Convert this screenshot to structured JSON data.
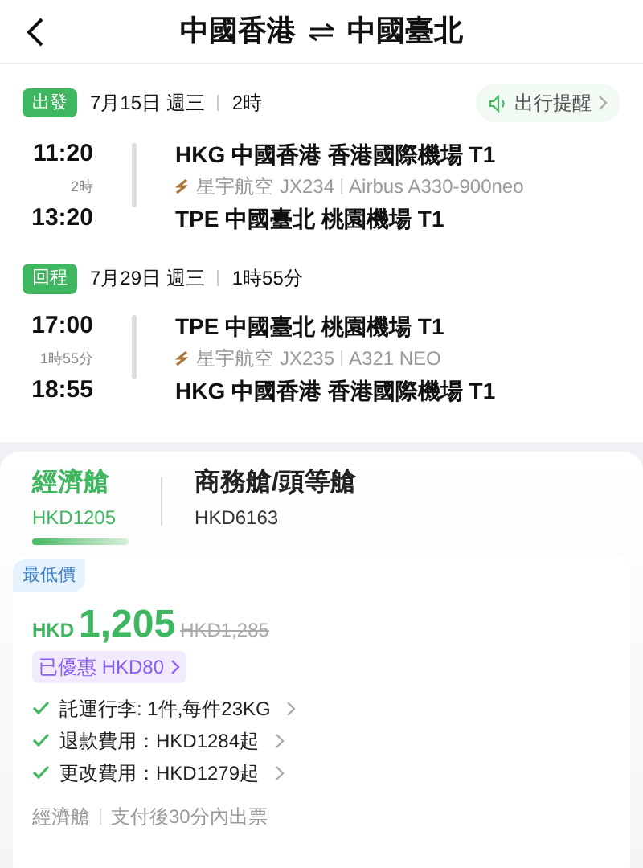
{
  "header": {
    "title_from": "中國香港",
    "title_to": "中國臺北"
  },
  "reminder": {
    "label": "出行提醒"
  },
  "segments": [
    {
      "badge": "出發",
      "date": "7月15日 週三",
      "duration": "2時",
      "dep_time": "11:20",
      "arr_time": "13:20",
      "flight_duration": "2時",
      "dep_airport": "HKG 中國香港 香港國際機場 T1",
      "airline": "星宇航空",
      "flight_no": "JX234",
      "aircraft": "Airbus A330-900neo",
      "arr_airport": "TPE 中國臺北 桃園機場 T1"
    },
    {
      "badge": "回程",
      "date": "7月29日 週三",
      "duration": "1時55分",
      "dep_time": "17:00",
      "arr_time": "18:55",
      "flight_duration": "1時55分",
      "dep_airport": "TPE 中國臺北 桃園機場 T1",
      "airline": "星宇航空",
      "flight_no": "JX235",
      "aircraft": "A321 NEO",
      "arr_airport": "HKG 中國香港 香港國際機場 T1"
    }
  ],
  "cabin_tabs": [
    {
      "name": "經濟艙",
      "price": "HKD1205",
      "selected": true
    },
    {
      "name": "商務艙/頭等艙",
      "price": "HKD6163",
      "selected": false
    }
  ],
  "fare": {
    "tag": "最低價",
    "currency": "HKD",
    "price": "1,205",
    "original_price": "HKD1,285",
    "discount": "已優惠 HKD80",
    "features": [
      "託運行李: 1件,每件23KG",
      "退款費用：HKD1284起",
      "更改費用：HKD1279起"
    ],
    "cabin": "經濟艙",
    "ticketing": "支付後30分內出票"
  }
}
